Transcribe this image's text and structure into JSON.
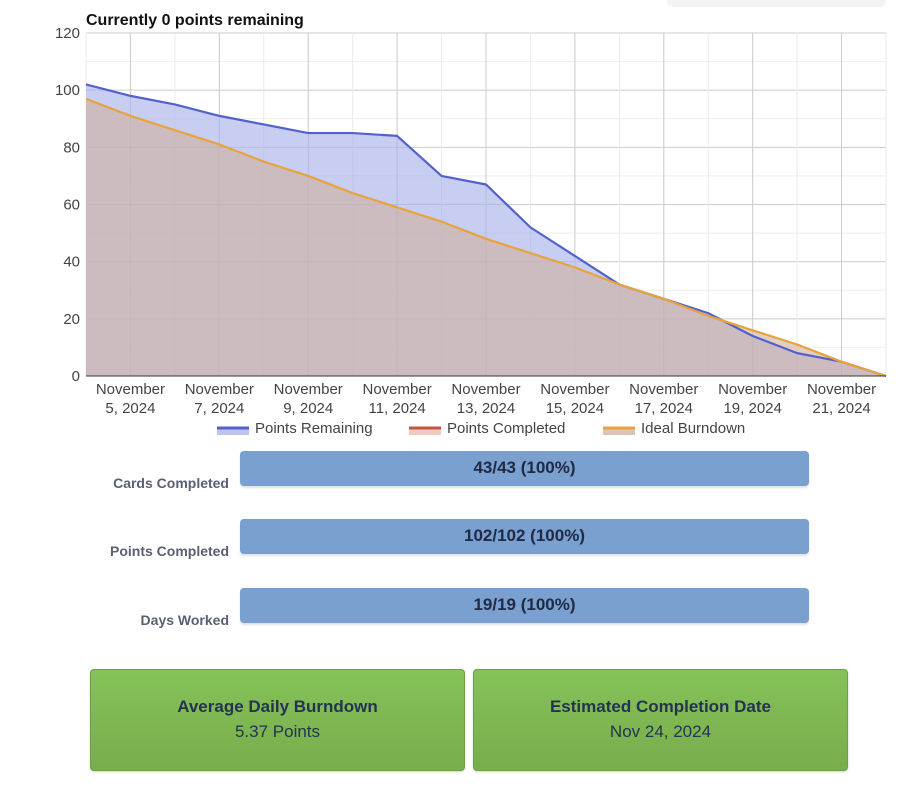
{
  "chart_data": {
    "type": "area",
    "title": "Currently 0 points remaining",
    "ylim": [
      0,
      120
    ],
    "y_ticks": [
      0,
      20,
      40,
      60,
      80,
      100,
      120
    ],
    "grid": true,
    "legend_position": "bottom",
    "x_start": "2024-11-04",
    "x_end": "2024-11-22",
    "x_tick_labels": [
      {
        "date": "2024-11-05",
        "line1": "November",
        "line2": "5, 2024"
      },
      {
        "date": "2024-11-07",
        "line1": "November",
        "line2": "7, 2024"
      },
      {
        "date": "2024-11-09",
        "line1": "November",
        "line2": "9, 2024"
      },
      {
        "date": "2024-11-11",
        "line1": "November",
        "line2": "11, 2024"
      },
      {
        "date": "2024-11-13",
        "line1": "November",
        "line2": "13, 2024"
      },
      {
        "date": "2024-11-15",
        "line1": "November",
        "line2": "15, 2024"
      },
      {
        "date": "2024-11-17",
        "line1": "November",
        "line2": "17, 2024"
      },
      {
        "date": "2024-11-19",
        "line1": "November",
        "line2": "19, 2024"
      },
      {
        "date": "2024-11-21",
        "line1": "November",
        "line2": "21, 2024"
      }
    ],
    "series": [
      {
        "name": "Points Remaining",
        "color": "#5361cc",
        "fill": "#a7b0ea",
        "points": [
          [
            "2024-11-04",
            102
          ],
          [
            "2024-11-05",
            98
          ],
          [
            "2024-11-06",
            95
          ],
          [
            "2024-11-07",
            91
          ],
          [
            "2024-11-08",
            88
          ],
          [
            "2024-11-09",
            85
          ],
          [
            "2024-11-10",
            85
          ],
          [
            "2024-11-11",
            84
          ],
          [
            "2024-11-12",
            70
          ],
          [
            "2024-11-13",
            67
          ],
          [
            "2024-11-14",
            52
          ],
          [
            "2024-11-15",
            42
          ],
          [
            "2024-11-16",
            32
          ],
          [
            "2024-11-17",
            27
          ],
          [
            "2024-11-18",
            22
          ],
          [
            "2024-11-19",
            14
          ],
          [
            "2024-11-20",
            8
          ],
          [
            "2024-11-21",
            5
          ],
          [
            "2024-11-22",
            0
          ]
        ]
      },
      {
        "name": "Points Completed",
        "color": "#c2553c",
        "fill": "#e7b8ae",
        "points": []
      },
      {
        "name": "Ideal Burndown",
        "color": "#e8a33a",
        "fill": "#cfb2a2",
        "points": [
          [
            "2024-11-04",
            97
          ],
          [
            "2024-11-05",
            91
          ],
          [
            "2024-11-06",
            86
          ],
          [
            "2024-11-07",
            81
          ],
          [
            "2024-11-08",
            75
          ],
          [
            "2024-11-09",
            70
          ],
          [
            "2024-11-10",
            64
          ],
          [
            "2024-11-11",
            59
          ],
          [
            "2024-11-12",
            54
          ],
          [
            "2024-11-13",
            48
          ],
          [
            "2024-11-14",
            43
          ],
          [
            "2024-11-15",
            38
          ],
          [
            "2024-11-16",
            32
          ],
          [
            "2024-11-17",
            27
          ],
          [
            "2024-11-18",
            21
          ],
          [
            "2024-11-19",
            16
          ],
          [
            "2024-11-20",
            11
          ],
          [
            "2024-11-21",
            5
          ],
          [
            "2024-11-22",
            0
          ]
        ]
      }
    ]
  },
  "progress": [
    {
      "label": "Cards Completed",
      "text": "43/43 (100%)",
      "fraction": 1.0
    },
    {
      "label": "Points Completed",
      "text": "102/102 (100%)",
      "fraction": 1.0
    },
    {
      "label": "Days Worked",
      "text": "19/19 (100%)",
      "fraction": 1.0
    }
  ],
  "stats": {
    "avg_title": "Average Daily Burndown",
    "avg_value": "5.37 Points",
    "eta_title": "Estimated Completion Date",
    "eta_value": "Nov 24, 2024"
  }
}
